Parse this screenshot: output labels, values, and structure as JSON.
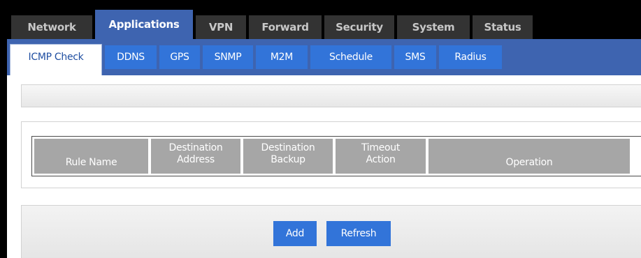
{
  "top_nav": {
    "tabs": [
      {
        "label": "Network"
      },
      {
        "label": "Applications"
      },
      {
        "label": "VPN"
      },
      {
        "label": "Forward"
      },
      {
        "label": "Security"
      },
      {
        "label": "System"
      },
      {
        "label": "Status"
      }
    ],
    "active": "Applications"
  },
  "sub_nav": {
    "tabs": [
      {
        "label": "ICMP Check"
      },
      {
        "label": "DDNS"
      },
      {
        "label": "GPS"
      },
      {
        "label": "SNMP"
      },
      {
        "label": "M2M"
      },
      {
        "label": "Schedule"
      },
      {
        "label": "SMS"
      },
      {
        "label": "Radius"
      }
    ],
    "active": "ICMP Check"
  },
  "table": {
    "columns": [
      {
        "line1": "Rule Name"
      },
      {
        "line1": "Destination",
        "line2": "Address"
      },
      {
        "line1": "Destination",
        "line2": "Backup"
      },
      {
        "line1": "Timeout",
        "line2": "Action"
      },
      {
        "line1": "Operation"
      }
    ]
  },
  "buttons": {
    "add": "Add",
    "refresh": "Refresh"
  },
  "colors": {
    "accent": "#3e64b0",
    "button": "#3274d9",
    "tab_inactive": "#333333",
    "header_cell": "#a6a6a6"
  }
}
